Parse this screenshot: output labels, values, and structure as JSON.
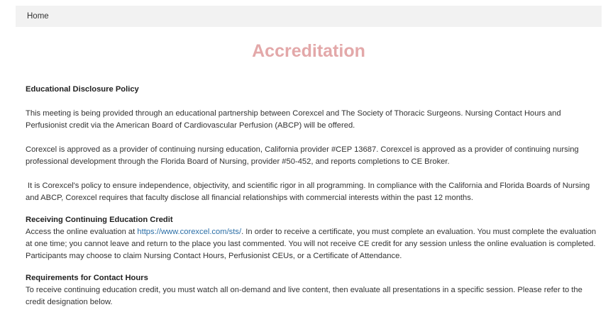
{
  "breadcrumb": {
    "home": "Home"
  },
  "page": {
    "title": "Accreditation"
  },
  "sections": {
    "disclosure": {
      "heading": "Educational Disclosure Policy",
      "p1": "This meeting is being provided through an educational partnership between Corexcel and The Society of Thoracic Surgeons. Nursing Contact Hours and Perfusionist credit via the American Board of Cardiovascular Perfusion (ABCP) will be offered.",
      "p2": "Corexcel is approved as a provider of continuing nursing education, California provider #CEP 13687. Corexcel is approved as a provider of continuing nursing professional development through the Florida Board of Nursing, provider #50-452, and reports completions to CE Broker.",
      "p3": "It is Corexcel's policy to ensure independence, objectivity, and scientific rigor in all programming. In compliance with the California and Florida Boards of Nursing and ABCP, Corexcel requires that faculty disclose all financial relationships with commercial interests within the past 12 months."
    },
    "receiving": {
      "heading": "Receiving Continuing Education Credit",
      "text_before_link": "Access the online evaluation at ",
      "link": "https://www.corexcel.com/sts/",
      "text_after_link": ". In order to receive a certificate, you must complete an evaluation. You must complete the evaluation at one time; you cannot leave and return to the place you last commented. You will not receive CE credit for any session unless the online evaluation is completed. Participants may choose to claim Nursing Contact Hours, Perfusionist CEUs, or a Certificate of Attendance."
    },
    "requirements": {
      "heading": "Requirements for Contact Hours",
      "p1": "To receive continuing education credit, you must watch all on-demand and live content, then evaluate all presentations in a specific session. Please refer to the credit designation below."
    }
  }
}
